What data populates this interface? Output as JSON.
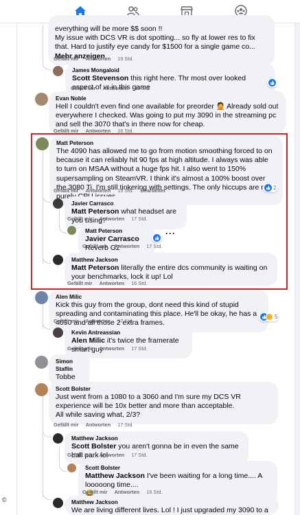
{
  "nav": {
    "tabs": [
      {
        "icon": "home-icon",
        "active": true
      },
      {
        "icon": "friends-icon",
        "active": false
      },
      {
        "icon": "marketplace-icon",
        "active": false
      },
      {
        "icon": "groups-icon",
        "active": false
      }
    ]
  },
  "labels": {
    "like": "Gefällt mir",
    "reply": "Antworten",
    "edited": "Bearbeitet",
    "more": "Mehr anzeigen"
  },
  "colors": {
    "accent": "#1877f2",
    "highlight": "#d32027",
    "bubble": "#f0f2f5",
    "meta": "#65676b"
  },
  "copyright": "©",
  "comments": {
    "c0": {
      "text_l1": "everything will be more $$ soon !!",
      "text_l2": "My issue with DCS VR is dot spotting... so fly at lower res to fix that. Hard to justify eye candy for $1500 for a single game co...",
      "time": "19 Std."
    },
    "c1": {
      "author": "James Mongaloid",
      "mention": "Scott Stevenson",
      "text": " this right here. Thr most over looked aspect of vr in this game",
      "time": "19 Std."
    },
    "c2": {
      "author": "Evan Noble",
      "text": "Hell I couldn't even find one available for preorder 🤦 Already sold out everywhere I checked. Was going to put my 3090 in the streaming pc and sell the 3070 that's in there now for cheap.",
      "time": "16 Std."
    },
    "c3": {
      "author": "Matt Peterson",
      "text": "The 4090 has allowed me to go from motion smoothing forced to on because it can reliably hit 90 fps at high altitude. I always was able to turn on MSAA without a huge fps hit. I also went to 150% supersampling on SteamVR. I think it's almost a 100% boost over the 3080 Ti. I'm still tinkering with settings. The only hiccups are not purely CPU issues.",
      "time": "19 Std.",
      "reactions": "2"
    },
    "c4": {
      "author": "Javier Carrasco",
      "mention": "Matt Peterson",
      "text": " what headset are you using?",
      "time": "17 Std."
    },
    "c5": {
      "author": "Matt Peterson",
      "mention": "Javier Carrasco",
      "text": " Reverb G2",
      "time": "17 Std.",
      "menu": "···"
    },
    "c6": {
      "author": "Matthew Jackson",
      "mention": "Matt Peterson",
      "text": " literally the entire dcs community is waiting on your benchmarks, lock it up! Lol",
      "time": "16 Std."
    },
    "c7": {
      "author": "Alen Milic",
      "text": "Kick this guy from the group, dont need this kind of stupid spreading and contaminating this place. He'll be okay, he has a 4090 and all those 2 extra frames.",
      "time": "17 Std.",
      "reactions": "5"
    },
    "c8": {
      "author": "Kevin Antreassian",
      "mention": "Alen Milic",
      "text": " it's twice the framerate smart guy",
      "time": "17 Std."
    },
    "c9": {
      "author": "Simon Staflin",
      "text": "Tobbe"
    },
    "c10": {
      "author": "Scott Bolster",
      "text": "Just went from a 1080 to a 3060 and I'm sure my DCS VR experience will be 10x better and more than acceptable.",
      "text2": "All while saving what, 2/3?",
      "time": "17 Std."
    },
    "c11": {
      "author": "Matthew Jackson",
      "mention": "Scott Bolster",
      "text": " you aren't gonna be in even the same ball park lol",
      "time": "17 Std."
    },
    "c12": {
      "author": "Scott Bolster",
      "mention": "Matthew Jackson",
      "text": " I've been waiting for a long time.... A looooong time....",
      "emoji": "😂",
      "time": "16 Std."
    },
    "c13": {
      "author": "Matthew Jackson",
      "text": "We are living different lives. Lol ! I just upgraded my 3090 to a 3090 ti."
    }
  }
}
